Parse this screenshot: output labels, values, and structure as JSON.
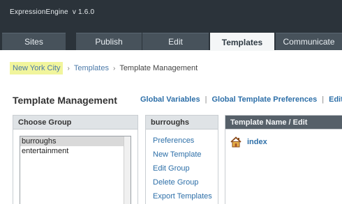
{
  "app": {
    "name": "ExpressionEngine",
    "version": "v 1.6.0"
  },
  "tabs": [
    {
      "label": "Sites"
    },
    {
      "label": "Publish"
    },
    {
      "label": "Edit"
    },
    {
      "label": "Templates"
    },
    {
      "label": "Communicate"
    }
  ],
  "breadcrumb": {
    "home": "New York City",
    "sep": "›",
    "section": "Templates",
    "current": "Template Management"
  },
  "page": {
    "title": "Template Management",
    "links": [
      "Global Variables",
      "Global Template Preferences",
      "Edit"
    ],
    "pipe": "|"
  },
  "group_panel": {
    "header": "Choose Group",
    "items": [
      "burroughs",
      "entertainment"
    ]
  },
  "actions_panel": {
    "header": "burroughs",
    "items": [
      "Preferences",
      "New Template",
      "Edit Group",
      "Delete Group",
      "Export Templates"
    ]
  },
  "template_panel": {
    "header": "Template Name / Edit",
    "templates": [
      {
        "name": "index",
        "icon": "house-icon"
      }
    ]
  },
  "colors": {
    "topbar": "#2b333a",
    "tab": "#47525b",
    "link": "#2d6fa8",
    "highlight": "#f1f59c"
  }
}
